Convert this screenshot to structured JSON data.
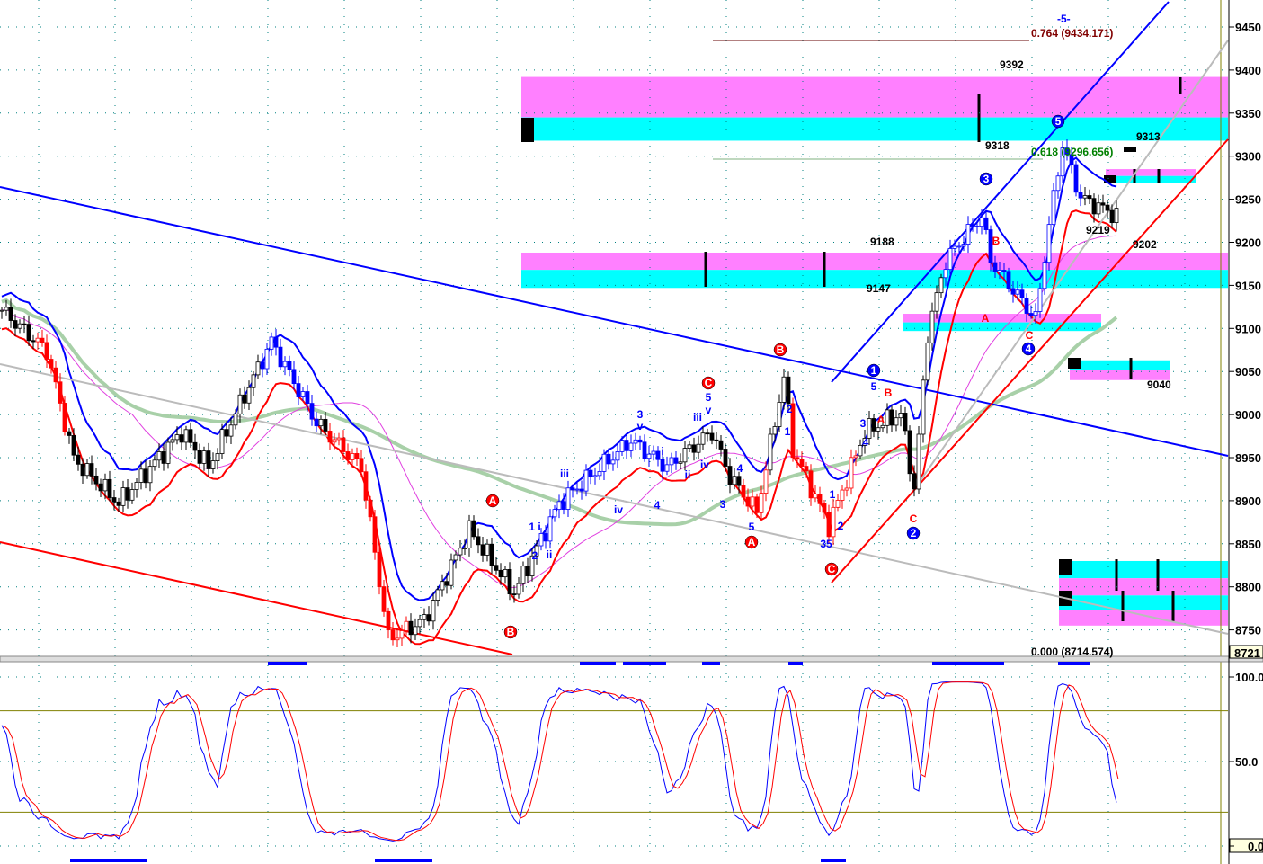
{
  "chart_data": {
    "type": "candlestick",
    "price_axis": {
      "ticks": [
        9450,
        9400,
        9350,
        9300,
        9250,
        9200,
        9150,
        9100,
        9050,
        9000,
        8950,
        8900,
        8850,
        8800,
        8750
      ],
      "range": [
        8721,
        9480
      ],
      "current_price": "8721"
    },
    "oscillator_axis": {
      "ticks": [
        "100.0",
        "50.0",
        "0.0"
      ],
      "range": [
        0,
        100
      ],
      "overbought": 80,
      "oversold": 20
    },
    "price_keypoints": [
      [
        0,
        9121
      ],
      [
        10,
        9074
      ],
      [
        16,
        8949
      ],
      [
        26,
        8897
      ],
      [
        40,
        8980
      ],
      [
        46,
        8939
      ],
      [
        60,
        9085
      ],
      [
        70,
        8991
      ],
      [
        80,
        8939
      ],
      [
        86,
        8740
      ],
      [
        94,
        8761
      ],
      [
        104,
        8866
      ],
      [
        114,
        8793
      ],
      [
        124,
        8897
      ],
      [
        140,
        8970
      ],
      [
        148,
        8939
      ],
      [
        158,
        8980
      ],
      [
        162,
        8928
      ],
      [
        168,
        8887
      ],
      [
        174,
        9044
      ],
      [
        176,
        8960
      ],
      [
        184,
        8871
      ],
      [
        192,
        8980
      ],
      [
        200,
        9001
      ],
      [
        203,
        8913
      ],
      [
        206,
        9095
      ],
      [
        210,
        9179
      ],
      [
        218,
        9231
      ],
      [
        220,
        9179
      ],
      [
        230,
        9111
      ],
      [
        233,
        9220
      ],
      [
        236,
        9314
      ],
      [
        240,
        9252
      ],
      [
        248,
        9231
      ]
    ],
    "price_labels": [
      "9392",
      "9318",
      "9313",
      "9188",
      "9147",
      "9219",
      "9202",
      "9040"
    ],
    "fib_labels": [
      "-5-",
      "0.764 (9434.171)",
      "0.618 (9296.656)",
      "0.000 (8714.574)"
    ],
    "wave_circles_red": [
      "A",
      "B",
      "C",
      "B",
      "A",
      "C"
    ],
    "wave_circles_blue": [
      "1",
      "2",
      "3",
      "4",
      "5"
    ],
    "wave_text": [
      "1 i",
      "2",
      "ii",
      "iii",
      "iv",
      "3",
      "v",
      "4",
      "i",
      "ii",
      "iii",
      "iv",
      "5",
      "v",
      "3",
      "4",
      "5",
      "2",
      "1",
      "1",
      "2",
      "35",
      "5",
      "3",
      "4",
      "A",
      "B",
      "C",
      "B",
      "A",
      "C"
    ],
    "zones": [
      {
        "color": "magenta",
        "from": 9345,
        "to": 9392
      },
      {
        "color": "cyan",
        "from": 9318,
        "to": 9345
      },
      {
        "color": "magenta",
        "from": 9168,
        "to": 9188
      },
      {
        "color": "cyan",
        "from": 9147,
        "to": 9168
      },
      {
        "color": "magenta",
        "from": 9107,
        "to": 9117
      },
      {
        "color": "cyan",
        "from": 9097,
        "to": 9107
      },
      {
        "color": "cyan",
        "from": 9052,
        "to": 9063
      },
      {
        "color": "magenta",
        "from": 9040,
        "to": 9052
      },
      {
        "color": "magenta",
        "from": 9277,
        "to": 9285
      },
      {
        "color": "cyan",
        "from": 9269,
        "to": 9277
      },
      {
        "color": "cyan",
        "from": 8810,
        "to": 8830
      },
      {
        "color": "magenta",
        "from": 8790,
        "to": 8810
      },
      {
        "color": "cyan",
        "from": 8773,
        "to": 8790
      },
      {
        "color": "magenta",
        "from": 8755,
        "to": 8773
      }
    ],
    "colors": {
      "magenta": "#ff80ff",
      "cyan": "#00ffff",
      "blue": "#0000ff",
      "red": "#ff0000",
      "green": "#a8d0a8",
      "pink": "#e040e0",
      "grid": "#008080",
      "olive": "#808000"
    }
  }
}
